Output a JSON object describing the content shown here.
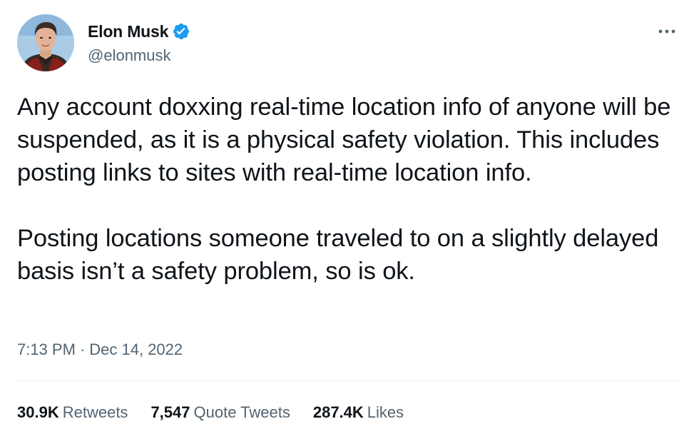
{
  "author": {
    "display_name": "Elon Musk",
    "handle": "@elonmusk",
    "verified": true,
    "avatar_icon": "user-avatar-photo"
  },
  "menu": {
    "more_icon": "more-horizontal-icon"
  },
  "tweet": {
    "paragraphs": [
      "Any account doxxing real-time location info of anyone will be suspended, as it is a physical safety violation. This includes posting links to sites with real-time location info.",
      "Posting locations someone traveled to on a slightly delayed basis isn’t a safety problem, so is ok."
    ],
    "time": "7:13 PM",
    "separator": "·",
    "date": "Dec 14, 2022"
  },
  "stats": {
    "retweets": {
      "value": "30.9K",
      "label": "Retweets"
    },
    "quote_tweets": {
      "value": "7,547",
      "label": "Quote Tweets"
    },
    "likes": {
      "value": "287.4K",
      "label": "Likes"
    }
  },
  "colors": {
    "text_primary": "#0f1419",
    "text_secondary": "#536471",
    "verified_blue": "#1d9bf0",
    "divider": "#eff3f4"
  }
}
